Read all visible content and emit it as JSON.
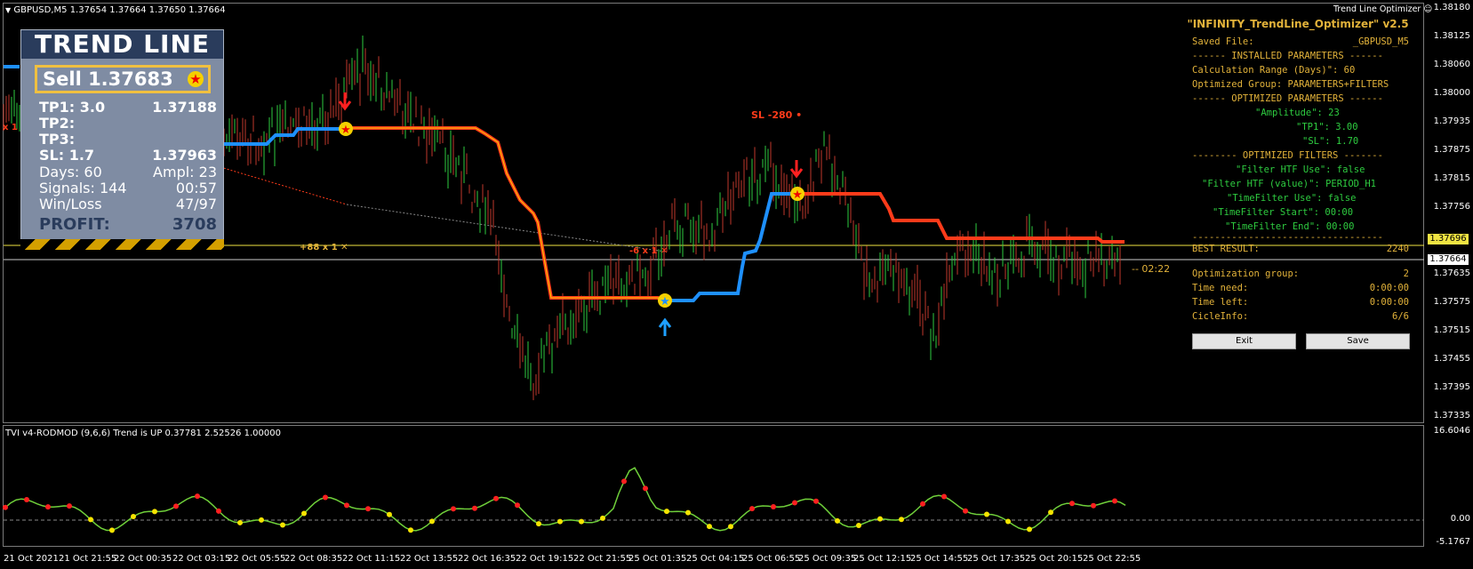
{
  "header": {
    "symbol_info": "GBPUSD,M5  1.37654 1.37664 1.37650 1.37664",
    "optimizer_label": "Trend Line Optimizer"
  },
  "price_axis": {
    "ticks": [
      "1.38180",
      "1.38125",
      "1.38060",
      "1.38000",
      "1.37935",
      "1.37875",
      "1.37815",
      "1.37756",
      "1.37696",
      "1.37664",
      "1.37635",
      "1.37575",
      "1.37515",
      "1.37455",
      "1.37395",
      "1.37335"
    ],
    "highlight_yellow": "1.37696",
    "highlight_white": "1.37664"
  },
  "sub_axis": {
    "ticks": [
      "16.6046",
      "0.00",
      "-5.1767"
    ]
  },
  "time_axis": [
    "21 Oct 2021",
    "21 Oct 21:55",
    "22 Oct 00:35",
    "22 Oct 03:15",
    "22 Oct 05:55",
    "22 Oct 08:35",
    "22 Oct 11:15",
    "22 Oct 13:55",
    "22 Oct 16:35",
    "22 Oct 19:15",
    "22 Oct 21:55",
    "25 Oct 01:35",
    "25 Oct 04:15",
    "25 Oct 06:55",
    "25 Oct 09:35",
    "25 Oct 12:15",
    "25 Oct 14:55",
    "25 Oct 17:35",
    "25 Oct 20:15",
    "25 Oct 22:55"
  ],
  "indicator_title": "TVI v4-RODMOD (9,6,6) Trend is UP 0.37781 2.52526 1.00000",
  "trend_panel": {
    "title": "TREND LINE",
    "sell_label": "Sell  1.37683",
    "tp1_label": "TP1: 3.0",
    "tp1_value": "1.37188",
    "tp2_label": "TP2:",
    "tp3_label": "TP3:",
    "sl_label": "SL: 1.7",
    "sl_value": "1.37963",
    "days": "Days: 60",
    "ampl": "Ampl: 23",
    "signals": "Signals: 144",
    "signals_time": "00:57",
    "winloss_label": "Win/Loss",
    "winloss_value": "47/97",
    "profit_label": "PROFIT:",
    "profit_value": "3708"
  },
  "chart_labels": {
    "sl": "SL -280",
    "plus88": "+88 x 1",
    "minus6": "-6 x 1",
    "timer": "-- 02:22",
    "x1": "x 1"
  },
  "optimizer": {
    "title": "\"INFINITY_TrendLine_Optimizer\" v2.5",
    "saved_file_label": "Saved File:",
    "saved_file_value": "_GBPUSD_M5",
    "installed_sep": "------ INSTALLED PARAMETERS ------",
    "calc_range": "Calculation Range (Days)\": 60",
    "opt_group": "Optimized Group: PARAMETERS+FILTERS",
    "opt_params_sep": "------ OPTIMIZED PARAMETERS ------",
    "amplitude": "\"Amplitude\": 23",
    "tp1": "\"TP1\": 3.00",
    "sl": "\"SL\": 1.70",
    "opt_filters_sep": "-------- OPTIMIZED FILTERS -------",
    "filter_htf_use": "\"Filter HTF Use\": false",
    "filter_htf_value": "\"Filter HTF (value)\": PERIOD_H1",
    "timefilter_use": "\"TimeFilter Use\": false",
    "timefilter_start": "\"TimeFilter Start\": 00:00",
    "timefilter_end": "\"TimeFilter End\": 00:00",
    "dash_sep": "----------------------------------",
    "best_label": "BEST RESULT:",
    "best_value": "2240",
    "optgroup_label": "Optimization group:",
    "optgroup_value": "2",
    "time_need_label": "Time need:",
    "time_need_value": "0:00:00",
    "time_left_label": "Time left:",
    "time_left_value": "0:00:00",
    "cicle_label": "CicleInfo:",
    "cicle_value": "6/6",
    "exit_label": "Exit",
    "save_label": "Save"
  },
  "colors": {
    "trend_red": "#ff3b1a",
    "trend_blue": "#1e90ff",
    "bull_candle": "#2ecc40",
    "bear_candle": "#c0392b",
    "optimizer_text": "#e2b23a"
  }
}
